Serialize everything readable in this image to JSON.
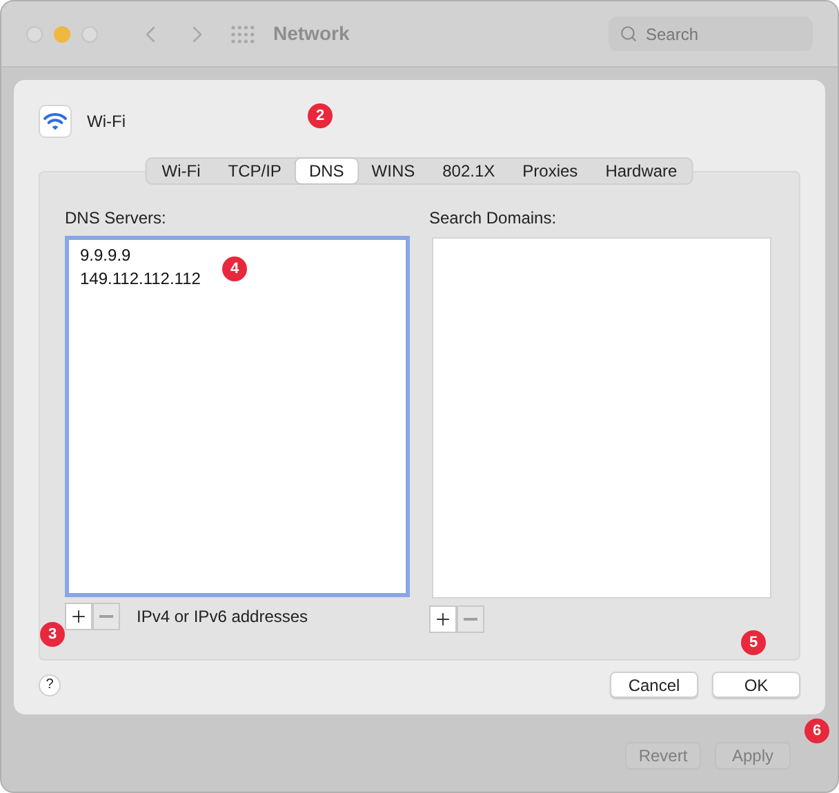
{
  "window": {
    "title": "Network",
    "search": {
      "placeholder": "Search"
    }
  },
  "sheet": {
    "service": "Wi-Fi",
    "tabs": [
      {
        "label": "Wi-Fi",
        "selected": false
      },
      {
        "label": "TCP/IP",
        "selected": false
      },
      {
        "label": "DNS",
        "selected": true
      },
      {
        "label": "WINS",
        "selected": false
      },
      {
        "label": "802.1X",
        "selected": false
      },
      {
        "label": "Proxies",
        "selected": false
      },
      {
        "label": "Hardware",
        "selected": false
      }
    ],
    "dns_servers": {
      "label": "DNS Servers:",
      "entries": [
        "9.9.9.9",
        "149.112.112.112"
      ],
      "focused": true,
      "controls": [
        {
          "kind": "add",
          "disabled": false
        },
        {
          "kind": "remove",
          "disabled": true
        }
      ],
      "hint": "IPv4 or IPv6 addresses"
    },
    "search_domains": {
      "label": "Search Domains:",
      "focused": false,
      "controls": [
        {
          "kind": "add",
          "disabled": false
        },
        {
          "kind": "remove",
          "disabled": true
        }
      ]
    },
    "help": "?",
    "buttons": [
      "Cancel",
      "OK"
    ]
  },
  "footer": {
    "buttons": [
      {
        "label": "Revert",
        "disabled": true
      },
      {
        "label": "Apply",
        "disabled": true
      }
    ]
  },
  "callouts": [
    "2",
    "3",
    "4",
    "5",
    "6"
  ]
}
